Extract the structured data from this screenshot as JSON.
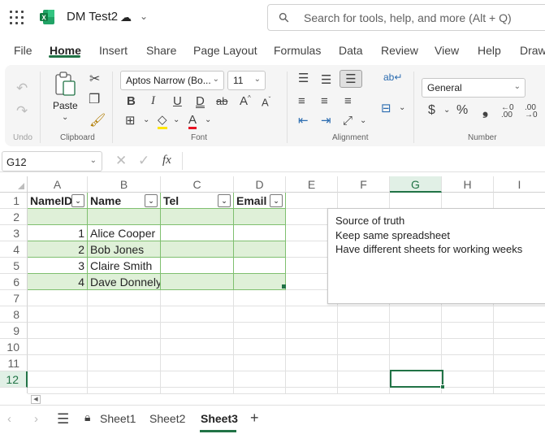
{
  "titlebar": {
    "doc_title": "DM Test2",
    "search_placeholder": "Search for tools, help, and more (Alt + Q)"
  },
  "menu": [
    "File",
    "Home",
    "Insert",
    "Share",
    "Page Layout",
    "Formulas",
    "Data",
    "Review",
    "View",
    "Help",
    "Draw"
  ],
  "ribbon": {
    "paste_label": "Paste",
    "font_name": "Aptos Narrow (Bo...",
    "font_size": "11",
    "number_format": "General",
    "groups": {
      "undo": "Undo",
      "clipboard": "Clipboard",
      "font": "Font",
      "alignment": "Alignment",
      "number": "Number"
    }
  },
  "formula_bar": {
    "name_box": "G12",
    "fx": "fx"
  },
  "grid": {
    "columns": [
      "A",
      "B",
      "C",
      "D",
      "E",
      "F",
      "G",
      "H",
      "I"
    ],
    "rows": [
      "1",
      "2",
      "3",
      "4",
      "5",
      "6",
      "7",
      "8",
      "9",
      "10",
      "11",
      "12"
    ],
    "selected_column": "G",
    "selected_row": "12",
    "table_headers": [
      "NameID",
      "Name",
      "Tel",
      "Email"
    ],
    "table_rows": [
      {
        "id": "",
        "name": ""
      },
      {
        "id": "1",
        "name": "Alice Cooper"
      },
      {
        "id": "2",
        "name": "Bob Jones"
      },
      {
        "id": "3",
        "name": "Claire Smith"
      },
      {
        "id": "4",
        "name": "Dave Donnely"
      }
    ]
  },
  "note": {
    "lines": [
      "Source of truth",
      "Keep same spreadsheet",
      "Have different sheets for working weeks"
    ]
  },
  "sheets": {
    "tabs": [
      "Sheet1",
      "Sheet2",
      "Sheet3"
    ],
    "active": "Sheet3"
  },
  "colors": {
    "accent": "#217346",
    "table_band": "#dff0d8"
  }
}
